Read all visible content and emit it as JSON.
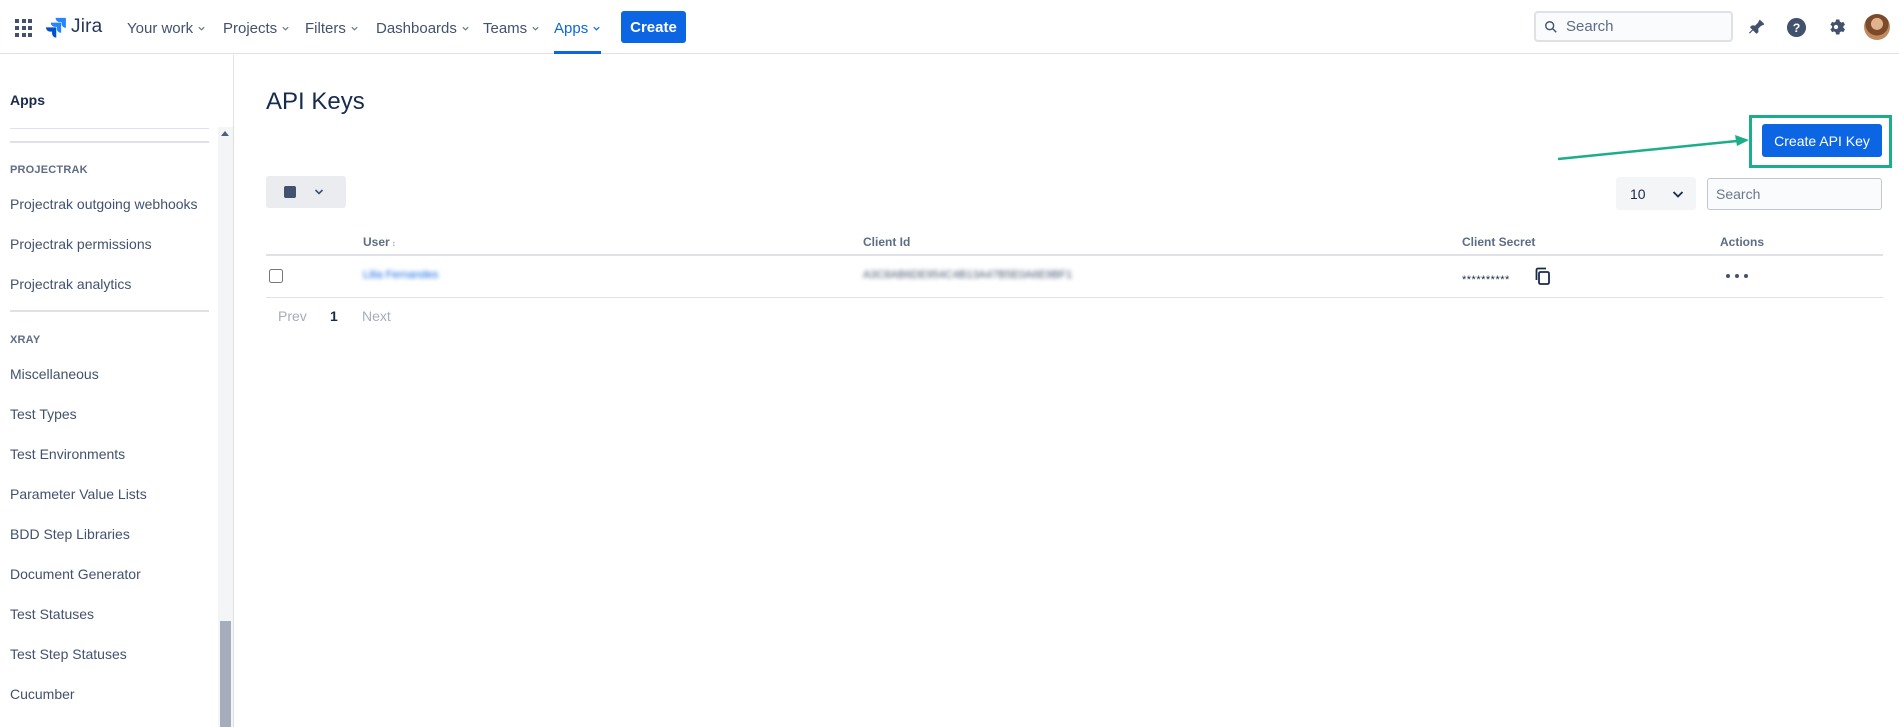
{
  "topnav": {
    "brand": "Jira",
    "items": [
      {
        "label": "Your work"
      },
      {
        "label": "Projects"
      },
      {
        "label": "Filters"
      },
      {
        "label": "Dashboards"
      },
      {
        "label": "Teams"
      },
      {
        "label": "Apps",
        "active": true
      }
    ],
    "create_label": "Create",
    "search_placeholder": "Search",
    "icons": [
      "app-switcher-icon",
      "notifications-icon",
      "help-icon",
      "settings-icon",
      "avatar"
    ]
  },
  "sidebar": {
    "top_label": "Apps",
    "sections": [
      {
        "header": "PROJECTRAK",
        "items": [
          "Projectrak outgoing webhooks",
          "Projectrak permissions",
          "Projectrak analytics"
        ]
      },
      {
        "header": "XRAY",
        "items": [
          "Miscellaneous",
          "Test Types",
          "Test Environments",
          "Parameter Value Lists",
          "BDD Step Libraries",
          "Document Generator",
          "Test Statuses",
          "Test Step Statuses",
          "Cucumber"
        ]
      }
    ]
  },
  "main": {
    "title": "API Keys",
    "create_api_key_label": "Create API Key",
    "page_size": "10",
    "search_placeholder": "Search",
    "table": {
      "columns": [
        "User",
        "Client Id",
        "Client Secret",
        "Actions"
      ],
      "rows": [
        {
          "user": "Lilia Fernandes",
          "client_id": "A3C8AB6DE954C4B13A47B5E0A6E9BF1",
          "client_secret": "**********"
        }
      ]
    },
    "pagination": {
      "prev": "Prev",
      "current": "1",
      "next": "Next"
    }
  },
  "colors": {
    "accent": "#0c66e4",
    "highlight": "#1cae8a",
    "text": "#172b4d",
    "muted": "#42526e"
  }
}
